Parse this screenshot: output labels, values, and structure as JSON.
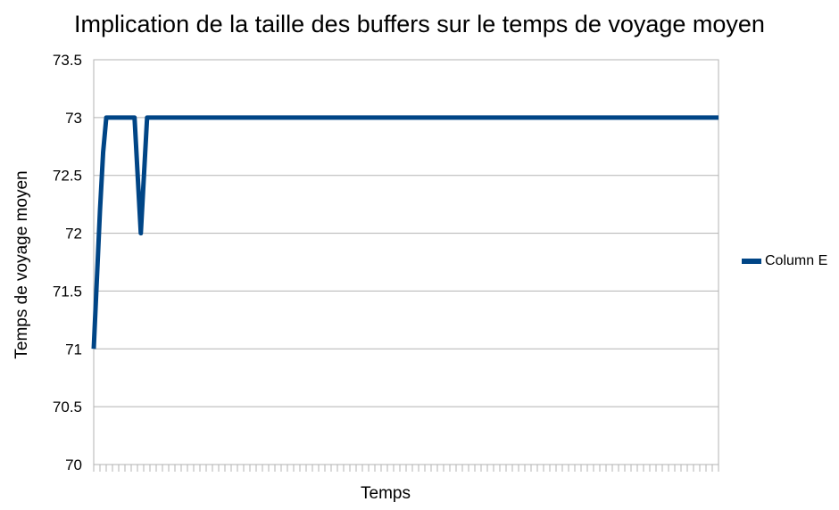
{
  "chart_data": {
    "type": "line",
    "title": "Implication de la taille des buffers sur le temps de voyage moyen",
    "xlabel": "Temps",
    "ylabel": "Temps de voyage moyen",
    "ylim": [
      70,
      73.5
    ],
    "yticks": [
      "70",
      "70.5",
      "71",
      "71.5",
      "72",
      "72.5",
      "73",
      "73.5"
    ],
    "grid": true,
    "legend_position": "right",
    "series": [
      {
        "name": "Column E",
        "color": "#004586",
        "x": [
          1,
          2,
          3,
          4,
          5,
          6,
          7,
          8,
          9,
          10,
          11,
          12,
          13,
          14,
          15,
          16,
          17,
          18,
          19,
          20,
          21,
          22,
          23,
          24,
          25,
          26,
          27,
          28,
          29,
          30,
          31,
          32,
          33,
          34,
          35,
          36,
          37,
          38,
          39,
          40,
          41,
          42,
          43,
          44,
          45,
          46,
          47,
          48,
          49,
          50,
          51,
          52,
          53,
          54,
          55,
          56,
          57,
          58,
          59,
          60,
          61,
          62,
          63,
          64,
          65,
          66,
          67,
          68,
          69,
          70,
          71,
          72,
          73,
          74,
          75,
          76,
          77,
          78,
          79,
          80,
          81,
          82,
          83,
          84,
          85,
          86,
          87,
          88,
          89,
          90,
          91,
          92,
          93,
          94,
          95,
          96,
          97,
          98,
          99,
          100,
          101,
          102,
          103,
          104,
          105,
          106,
          107,
          108,
          109,
          110,
          111,
          112,
          113,
          114,
          115,
          116,
          117,
          118,
          119,
          120,
          121,
          122,
          123,
          124,
          125,
          126,
          127,
          128,
          129,
          130,
          131,
          132,
          133,
          134,
          135,
          136,
          137,
          138,
          139,
          140,
          141,
          142,
          143,
          144,
          145,
          146,
          147,
          148,
          149,
          150,
          151,
          152,
          153,
          154,
          155,
          156,
          157,
          158,
          159,
          160,
          161,
          162,
          163,
          164,
          165,
          166,
          167,
          168,
          169,
          170,
          171,
          172,
          173,
          174,
          175,
          176,
          177,
          178,
          179,
          180,
          181,
          182,
          183,
          184,
          185,
          186,
          187,
          188,
          189,
          190,
          191,
          192,
          193,
          194,
          195,
          196,
          197,
          198,
          199,
          200
        ],
        "values": [
          71,
          71.6,
          72.2,
          72.7,
          73,
          73,
          73,
          73,
          73,
          73,
          73,
          73,
          73,
          73,
          72.5,
          72,
          72.5,
          73,
          73,
          73,
          73,
          73,
          73,
          73,
          73,
          73,
          73,
          73,
          73,
          73,
          73,
          73,
          73,
          73,
          73,
          73,
          73,
          73,
          73,
          73,
          73,
          73,
          73,
          73,
          73,
          73,
          73,
          73,
          73,
          73,
          73,
          73,
          73,
          73,
          73,
          73,
          73,
          73,
          73,
          73,
          73,
          73,
          73,
          73,
          73,
          73,
          73,
          73,
          73,
          73,
          73,
          73,
          73,
          73,
          73,
          73,
          73,
          73,
          73,
          73,
          73,
          73,
          73,
          73,
          73,
          73,
          73,
          73,
          73,
          73,
          73,
          73,
          73,
          73,
          73,
          73,
          73,
          73,
          73,
          73,
          73,
          73,
          73,
          73,
          73,
          73,
          73,
          73,
          73,
          73,
          73,
          73,
          73,
          73,
          73,
          73,
          73,
          73,
          73,
          73,
          73,
          73,
          73,
          73,
          73,
          73,
          73,
          73,
          73,
          73,
          73,
          73,
          73,
          73,
          73,
          73,
          73,
          73,
          73,
          73,
          73,
          73,
          73,
          73,
          73,
          73,
          73,
          73,
          73,
          73,
          73,
          73,
          73,
          73,
          73,
          73,
          73,
          73,
          73,
          73,
          73,
          73,
          73,
          73,
          73,
          73,
          73,
          73,
          73,
          73,
          73,
          73,
          73,
          73,
          73,
          73,
          73,
          73,
          73,
          73,
          73,
          73,
          73,
          73,
          73,
          73,
          73,
          73,
          73,
          73,
          73,
          73,
          73,
          73,
          73,
          73,
          73,
          73,
          73,
          73
        ]
      }
    ]
  }
}
